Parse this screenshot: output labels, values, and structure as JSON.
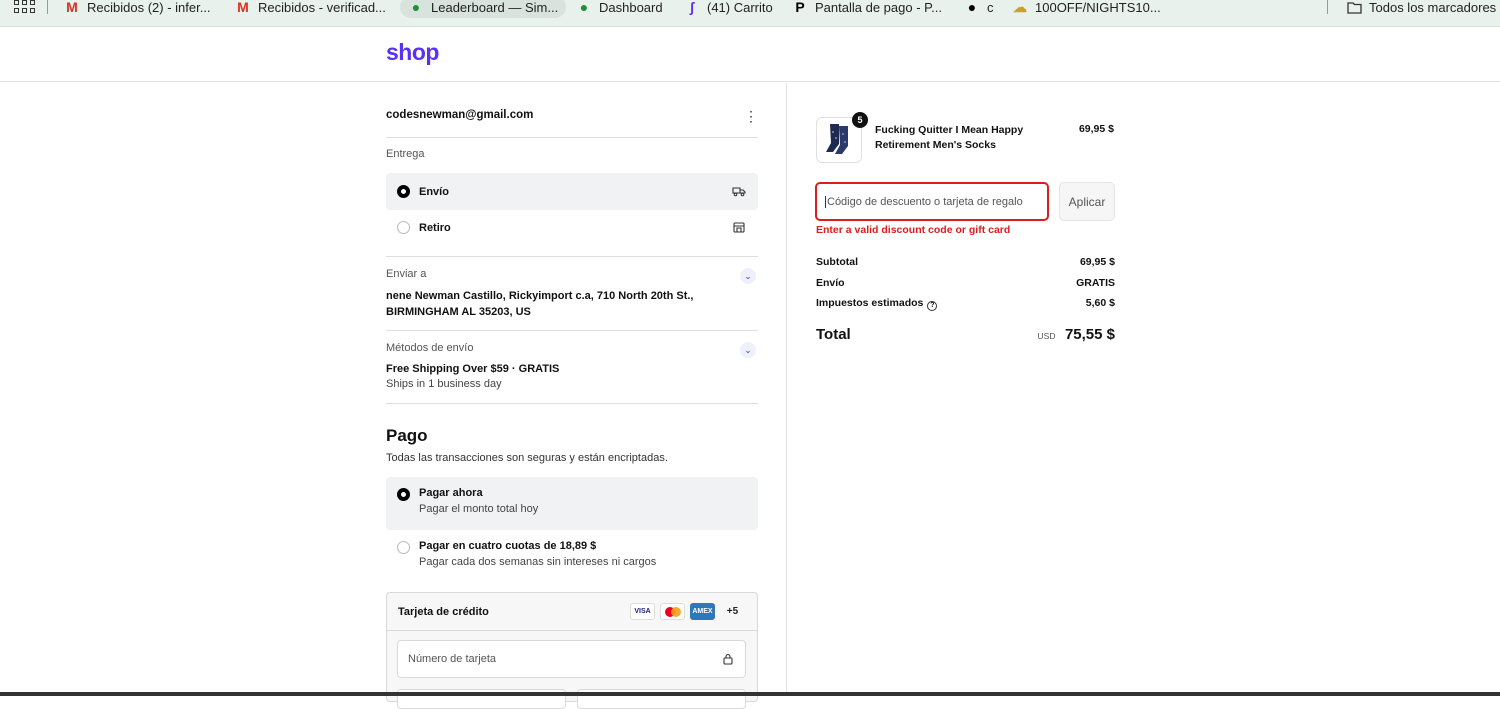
{
  "bookmarks": {
    "items": [
      {
        "label": "Recibidos (2) - infer...",
        "icon": "gmail-icon",
        "color": "#d93025"
      },
      {
        "label": "Recibidos - verificad...",
        "icon": "gmail-icon",
        "color": "#d93025"
      },
      {
        "label": "Leaderboard — Sim...",
        "icon": "leaf-icon",
        "color": "#1f8f3a"
      },
      {
        "label": "Dashboard",
        "icon": "leaf-icon",
        "color": "#1f8f3a"
      },
      {
        "label": "(41) Carrito",
        "icon": "s-icon",
        "color": "#5a31f4"
      },
      {
        "label": "Pantalla de pago - P...",
        "icon": "p-icon",
        "color": "#000000"
      },
      {
        "label": "c",
        "icon": "circle-s-icon",
        "color": "#000000"
      },
      {
        "label": "100OFF/NIGHTS10...",
        "icon": "cloud-icon",
        "color": "#c9a227"
      }
    ],
    "all_bookmarks": "Todos los marcadores"
  },
  "header": {
    "logo": "shop",
    "brand_color": "#5a31f4"
  },
  "contact": {
    "email": "codesnewman@gmail.com"
  },
  "delivery": {
    "label": "Entrega",
    "options": [
      {
        "label": "Envío",
        "selected": true,
        "icon": "truck-icon"
      },
      {
        "label": "Retiro",
        "selected": false,
        "icon": "store-icon"
      }
    ]
  },
  "ship_to": {
    "label": "Enviar a",
    "line1": "nene Newman Castillo, Rickyimport c.a, 710 North 20th St.,",
    "line2": "BIRMINGHAM AL 35203, US"
  },
  "shipping_method": {
    "label": "Métodos de envío",
    "name": "Free Shipping Over $59 · GRATIS",
    "detail": "Ships in 1 business day"
  },
  "payment": {
    "title": "Pago",
    "subtitle": "Todas las transacciones son seguras y están encriptadas.",
    "options": [
      {
        "title": "Pagar ahora",
        "sub": "Pagar el monto total hoy",
        "selected": true
      },
      {
        "title": "Pagar en cuatro cuotas de 18,89 $",
        "sub": "Pagar cada dos semanas sin intereses ni cargos",
        "selected": false
      }
    ],
    "card": {
      "title": "Tarjeta de crédito",
      "brands": [
        "VISA",
        "mastercard",
        "AMEX",
        "+5"
      ],
      "number_placeholder": "Número de tarjeta"
    }
  },
  "summary": {
    "product": {
      "name": "Fucking Quitter I Mean Happy Retirement Men's Socks",
      "price": "69,95 $",
      "qty": "5"
    },
    "discount_placeholder": "Código de descuento o tarjeta de regalo",
    "apply_label": "Aplicar",
    "error": "Enter a valid discount code or gift card",
    "rows": [
      {
        "label": "Subtotal",
        "value": "69,95 $"
      },
      {
        "label": "Envío",
        "value": "GRATIS"
      },
      {
        "label": "Impuestos estimados",
        "value": "5,60 $"
      }
    ],
    "total_label": "Total",
    "currency": "USD",
    "total": "75,55 $",
    "error_color": "#dd1d1d"
  }
}
